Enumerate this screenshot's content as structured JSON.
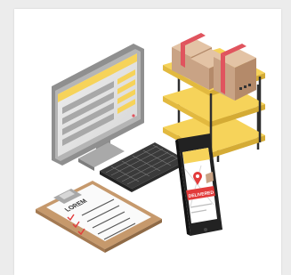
{
  "illustration": {
    "clipboard": {
      "heading": "LOREM"
    },
    "phone": {
      "badge_text": "DELIVERED"
    }
  },
  "colors": {
    "yellow": "#f6d35a",
    "monitor_gray": "#9a9a9a",
    "box_brown": "#c9a385",
    "tape_red": "#e0545e",
    "clipboard_tan": "#d7b48b",
    "check_red": "#e23b3b",
    "phone_black": "#222222"
  }
}
